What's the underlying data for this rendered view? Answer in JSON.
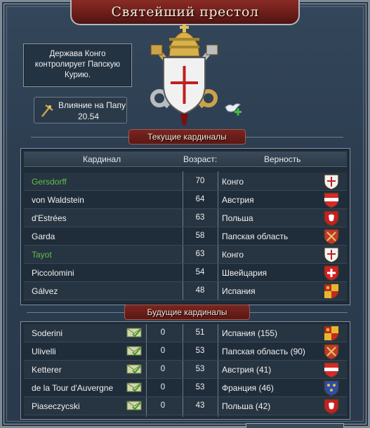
{
  "window": {
    "title": "Святейший престол"
  },
  "info": {
    "text_line1": "Держава Конго",
    "text_line2": "контролирует Папскую",
    "text_line3": "Курию."
  },
  "influence": {
    "label": "Влияние на Папу",
    "value": "20.54",
    "icon": "cross-staff-icon"
  },
  "current": {
    "section_title": "Текущие кардиналы",
    "headers": {
      "cardinal": "Кардинал",
      "age": "Возраст:",
      "loyalty": "Верность"
    },
    "rows": [
      {
        "name": "Gersdorff",
        "age": "70",
        "loyalty": "Конго",
        "highlight": true,
        "shield": "congo"
      },
      {
        "name": "von Waldstein",
        "age": "64",
        "loyalty": "Австрия",
        "highlight": false,
        "shield": "austria"
      },
      {
        "name": "d'Estrées",
        "age": "63",
        "loyalty": "Польша",
        "highlight": false,
        "shield": "poland"
      },
      {
        "name": "Garda",
        "age": "58",
        "loyalty": "Папская область",
        "highlight": false,
        "shield": "papal"
      },
      {
        "name": "Tayot",
        "age": "63",
        "loyalty": "Конго",
        "highlight": true,
        "shield": "congo"
      },
      {
        "name": "Piccolomini",
        "age": "54",
        "loyalty": "Швейцария",
        "highlight": false,
        "shield": "swiss"
      },
      {
        "name": "Gálvez",
        "age": "48",
        "loyalty": "Испания",
        "highlight": false,
        "shield": "spain"
      }
    ]
  },
  "future": {
    "section_title": "Будущие кардиналы",
    "rows": [
      {
        "name": "Soderini",
        "votes": "0",
        "age": "51",
        "loyalty": "Испания (155)",
        "shield": "spain"
      },
      {
        "name": "Ulivelli",
        "votes": "0",
        "age": "53",
        "loyalty": "Папская область (90)",
        "shield": "papal"
      },
      {
        "name": "Ketterer",
        "votes": "0",
        "age": "53",
        "loyalty": "Австрия (41)",
        "shield": "austria"
      },
      {
        "name": "de la Tour d'Auvergne",
        "votes": "0",
        "age": "53",
        "loyalty": "Франция (46)",
        "shield": "france"
      },
      {
        "name": "Piaseczycski",
        "votes": "0",
        "age": "43",
        "loyalty": "Польша (42)",
        "shield": "poland"
      }
    ]
  },
  "colors": {
    "highlight_name": "#5fbf4a",
    "title_red": "#7a2520"
  }
}
